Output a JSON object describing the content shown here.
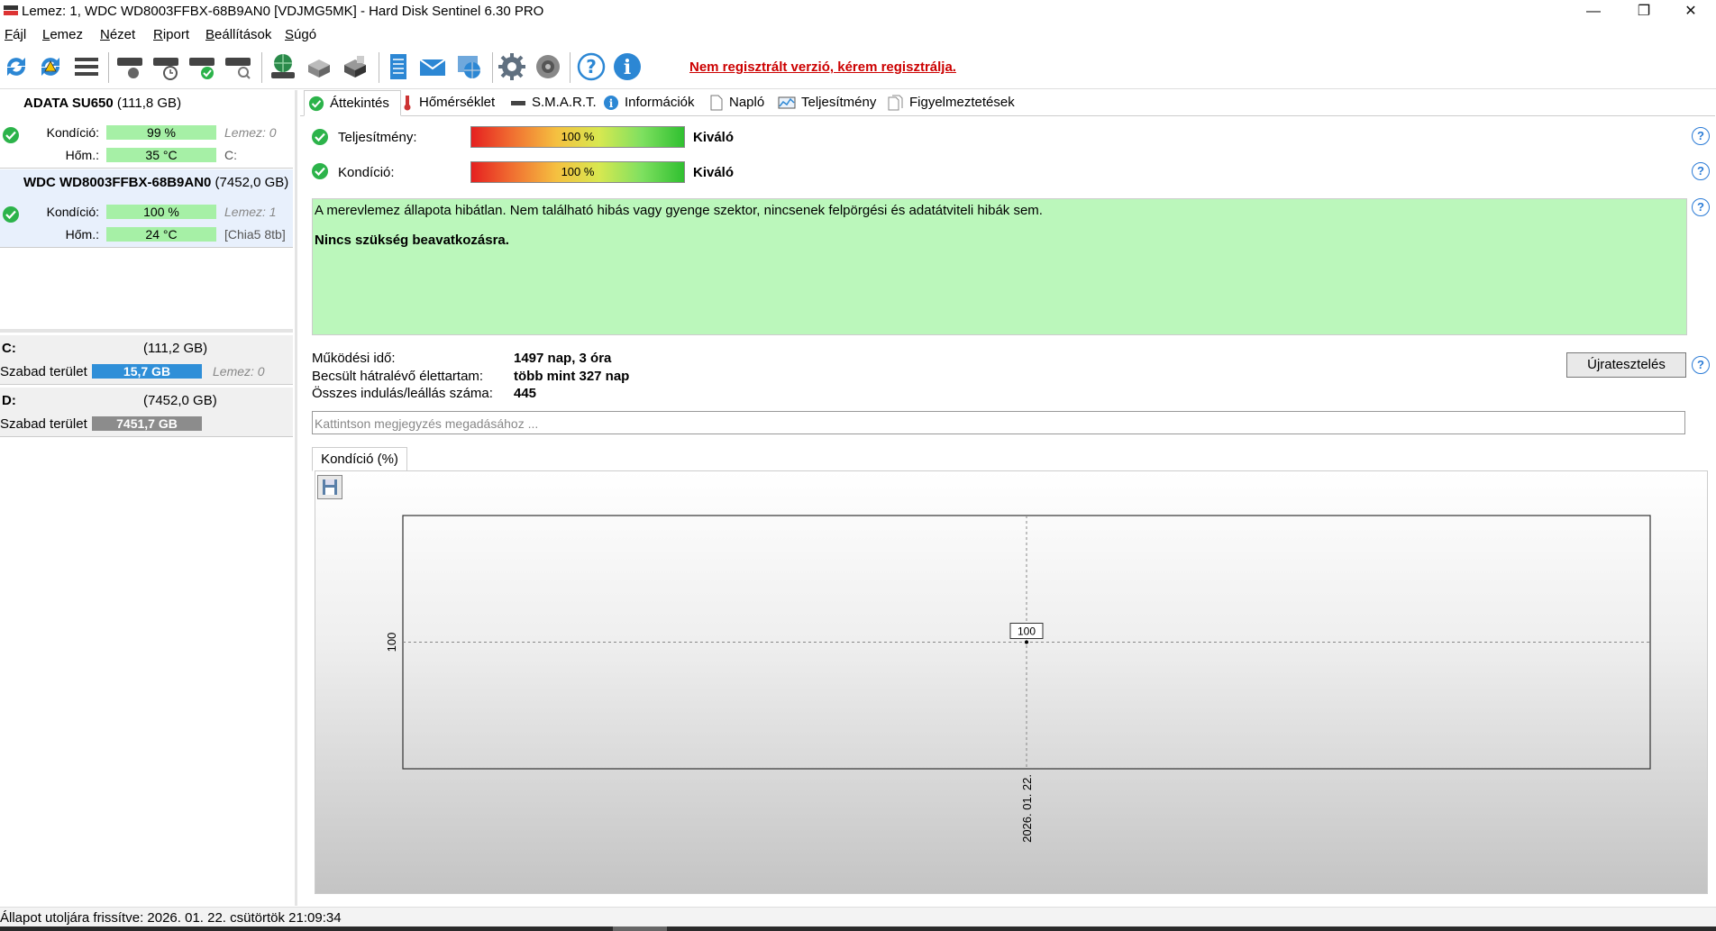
{
  "window": {
    "title": "Lemez: 1, WDC WD8003FFBX-68B9AN0 [VDJMG5MK]  -  Hard Disk Sentinel 6.30 PRO",
    "controls": {
      "minimize": "—",
      "maximize": "❐",
      "close": "✕"
    }
  },
  "menu": {
    "items": [
      {
        "underline": "F",
        "rest": "ájl"
      },
      {
        "underline": "L",
        "rest": "emez"
      },
      {
        "underline": "N",
        "rest": "ézet"
      },
      {
        "underline": "R",
        "rest": "iport"
      },
      {
        "underline": "B",
        "rest": "eállítások"
      },
      {
        "underline": "S",
        "rest": "úgó"
      }
    ]
  },
  "toolbar": {
    "icons": [
      "refresh-icon",
      "refresh-warning-icon",
      "disk-list-icon",
      "disk-surface-icon",
      "disk-clock-icon",
      "disk-check-icon",
      "disk-search-icon",
      "network-disk-icon",
      "printer-icon",
      "disk-export-icon",
      "report-icon",
      "email-icon",
      "web-report-icon",
      "settings-icon",
      "sound-icon",
      "help-icon",
      "info-icon"
    ],
    "unregistered_text": "Nem regisztrált verzió, kérem regisztrálja."
  },
  "disks": [
    {
      "name": "ADATA SU650",
      "size": "(111,8 GB)",
      "condition_label": "Kondíció:",
      "condition": "99 %",
      "condition_pct": 99,
      "temp_label": "Hőm.:",
      "temp": "35 °C",
      "extra1": "Lemez: 0",
      "extra2": "C:"
    },
    {
      "name": "WDC WD8003FFBX-68B9AN0",
      "size": "(7452,0 GB)",
      "condition_label": "Kondíció:",
      "condition": "100 %",
      "condition_pct": 100,
      "temp_label": "Hőm.:",
      "temp": "24 °C",
      "extra1": "Lemez: 1",
      "extra2": "[Chia5 8tb]"
    }
  ],
  "volumes": [
    {
      "name": "C:",
      "size": "(111,2 GB)",
      "free_label": "Szabad terület",
      "free": "15,7 GB",
      "extra": "Lemez: 0",
      "color": "#2f8fd8"
    },
    {
      "name": "D:",
      "size": "(7452,0 GB)",
      "free_label": "Szabad terület",
      "free": "7451,7 GB",
      "extra": "",
      "color": "#8c8c8c"
    }
  ],
  "tabs": [
    "Áttekintés",
    "Hőmérséklet",
    "S.M.A.R.T.",
    "Információk",
    "Napló",
    "Teljesítmény",
    "Figyelmeztetések"
  ],
  "overview": {
    "performance_label": "Teljesítmény:",
    "performance_value": "100 %",
    "performance_rating": "Kiváló",
    "condition_label": "Kondíció:",
    "condition_value": "100 %",
    "condition_rating": "Kiváló",
    "status_line1": "A merevlemez állapota hibátlan. Nem található hibás vagy gyenge szektor, nincsenek felpörgési és adatátviteli hibák sem.",
    "status_line2": "Nincs szükség beavatkozásra.",
    "power_on_label": "Működési idő:",
    "power_on_value": "1497 nap, 3 óra",
    "lifetime_label": "Becsült hátralévő élettartam:",
    "lifetime_value": "több mint 327 nap",
    "startstop_label": "Összes indulás/leállás száma:",
    "startstop_value": "445",
    "retest_button": "Újratesztelés",
    "comment_placeholder": "Kattintson megjegyzés megadásához ..."
  },
  "chart_tab_label": "Kondíció  (%)",
  "chart_data": {
    "type": "line",
    "x": [
      "2026. 01. 22."
    ],
    "series": [
      {
        "values": [
          100
        ]
      }
    ],
    "y_tick": "100",
    "point_label": "100",
    "ylim": [
      100,
      100
    ],
    "grid": true
  },
  "statusbar": {
    "text": "Állapot utoljára frissítve: 2026. 01. 22. csütörtök 21:09:34"
  }
}
